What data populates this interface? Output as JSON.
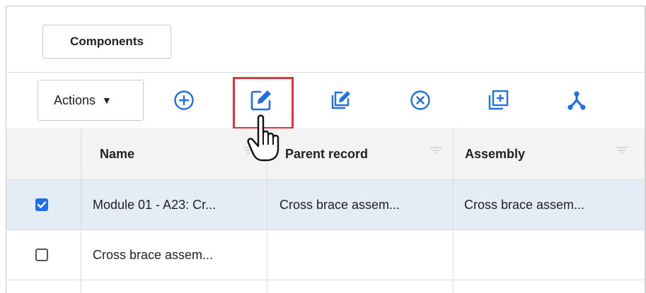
{
  "tabs": {
    "components_label": "Components"
  },
  "toolbar": {
    "actions_label": "Actions",
    "actions_caret": "▼",
    "tools": [
      {
        "icon": "add-circle-icon"
      },
      {
        "icon": "edit-icon",
        "highlighted": true
      },
      {
        "icon": "edit-multiple-icon"
      },
      {
        "icon": "delete-circle-icon"
      },
      {
        "icon": "copy-add-icon"
      },
      {
        "icon": "hierarchy-icon"
      }
    ]
  },
  "grid": {
    "columns": [
      "Name",
      "Parent record",
      "Assembly"
    ],
    "rows": [
      {
        "checked": true,
        "name": "Module 01 - A23: Cr...",
        "parent": "Cross brace assem...",
        "assembly": "Cross brace assem..."
      },
      {
        "checked": false,
        "name": "Cross brace assem...",
        "parent": "",
        "assembly": ""
      }
    ]
  },
  "colors": {
    "accent": "#1f6fe5",
    "highlight": "#e0343a",
    "selected_row": "#e4ecf5",
    "header_bg": "#f3f3f3"
  }
}
